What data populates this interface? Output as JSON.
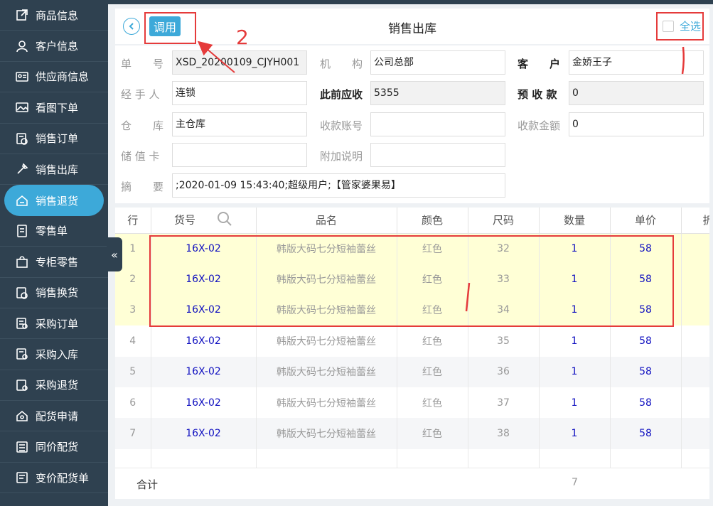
{
  "sidebar": {
    "items": [
      {
        "label": "商品信息",
        "icon": "edit-icon"
      },
      {
        "label": "客户信息",
        "icon": "user-icon"
      },
      {
        "label": "供应商信息",
        "icon": "id-card-icon"
      },
      {
        "label": "看图下单",
        "icon": "image-icon"
      },
      {
        "label": "销售订单",
        "icon": "order-icon"
      },
      {
        "label": "销售出库",
        "icon": "shovel-icon"
      },
      {
        "label": "销售退货",
        "icon": "return-box-icon"
      },
      {
        "label": "零售单",
        "icon": "receipt-icon"
      },
      {
        "label": "专柜零售",
        "icon": "bag-icon"
      },
      {
        "label": "销售换货",
        "icon": "exchange-icon"
      },
      {
        "label": "采购订单",
        "icon": "purchase-order-icon"
      },
      {
        "label": "采购入库",
        "icon": "stock-in-icon"
      },
      {
        "label": "采购退货",
        "icon": "purchase-return-icon"
      },
      {
        "label": "配货申请",
        "icon": "box-icon"
      },
      {
        "label": "同价配货",
        "icon": "same-price-icon"
      },
      {
        "label": "变价配货单",
        "icon": "price-change-icon"
      }
    ],
    "active_index": 6,
    "collapse_glyph": "«"
  },
  "header": {
    "invoke_label": "调用",
    "title": "销售出库",
    "select_all_label": "全选"
  },
  "form": {
    "order_no_label": "单　　号",
    "order_no_value": "XSD_20200109_CJYH001",
    "org_label": "机　　构",
    "org_value": "公司总部",
    "customer_label": "客　　户",
    "customer_value": "金娇王子",
    "handler_label": "经 手 人",
    "handler_value": "连锁",
    "prev_receivable_label": "此前应收",
    "prev_receivable_value": "5355",
    "prepaid_label": "预 收 款",
    "prepaid_value": "0",
    "warehouse_label": "仓　　库",
    "warehouse_value": "主仓库",
    "account_label": "收款账号",
    "account_value": "",
    "amount_label": "收款金额",
    "amount_value": "0",
    "card_label": "储 值 卡",
    "card_value": "",
    "note_label": "附加说明",
    "note_value": "",
    "summary_label": "摘　　要",
    "summary_value": ";2020-01-09 15:43:40;超级用户;【管家婆果易】"
  },
  "table": {
    "headers": [
      "行",
      "货号",
      "品名",
      "颜色",
      "尺码",
      "数量",
      "单价",
      "折"
    ],
    "rows": [
      {
        "idx": "1",
        "code": "16X-02",
        "name": "韩版大码七分短袖蕾丝",
        "color": "红色",
        "size": "32",
        "qty": "1",
        "price": "58"
      },
      {
        "idx": "2",
        "code": "16X-02",
        "name": "韩版大码七分短袖蕾丝",
        "color": "红色",
        "size": "33",
        "qty": "1",
        "price": "58"
      },
      {
        "idx": "3",
        "code": "16X-02",
        "name": "韩版大码七分短袖蕾丝",
        "color": "红色",
        "size": "34",
        "qty": "1",
        "price": "58"
      },
      {
        "idx": "4",
        "code": "16X-02",
        "name": "韩版大码七分短袖蕾丝",
        "color": "红色",
        "size": "35",
        "qty": "1",
        "price": "58"
      },
      {
        "idx": "5",
        "code": "16X-02",
        "name": "韩版大码七分短袖蕾丝",
        "color": "红色",
        "size": "36",
        "qty": "1",
        "price": "58"
      },
      {
        "idx": "6",
        "code": "16X-02",
        "name": "韩版大码七分短袖蕾丝",
        "color": "红色",
        "size": "37",
        "qty": "1",
        "price": "58"
      },
      {
        "idx": "7",
        "code": "16X-02",
        "name": "韩版大码七分短袖蕾丝",
        "color": "红色",
        "size": "38",
        "qty": "1",
        "price": "58"
      }
    ],
    "total_label": "合计",
    "total_qty": "7"
  },
  "annotations": {
    "step_number": "2",
    "color": "#e53b3b"
  }
}
